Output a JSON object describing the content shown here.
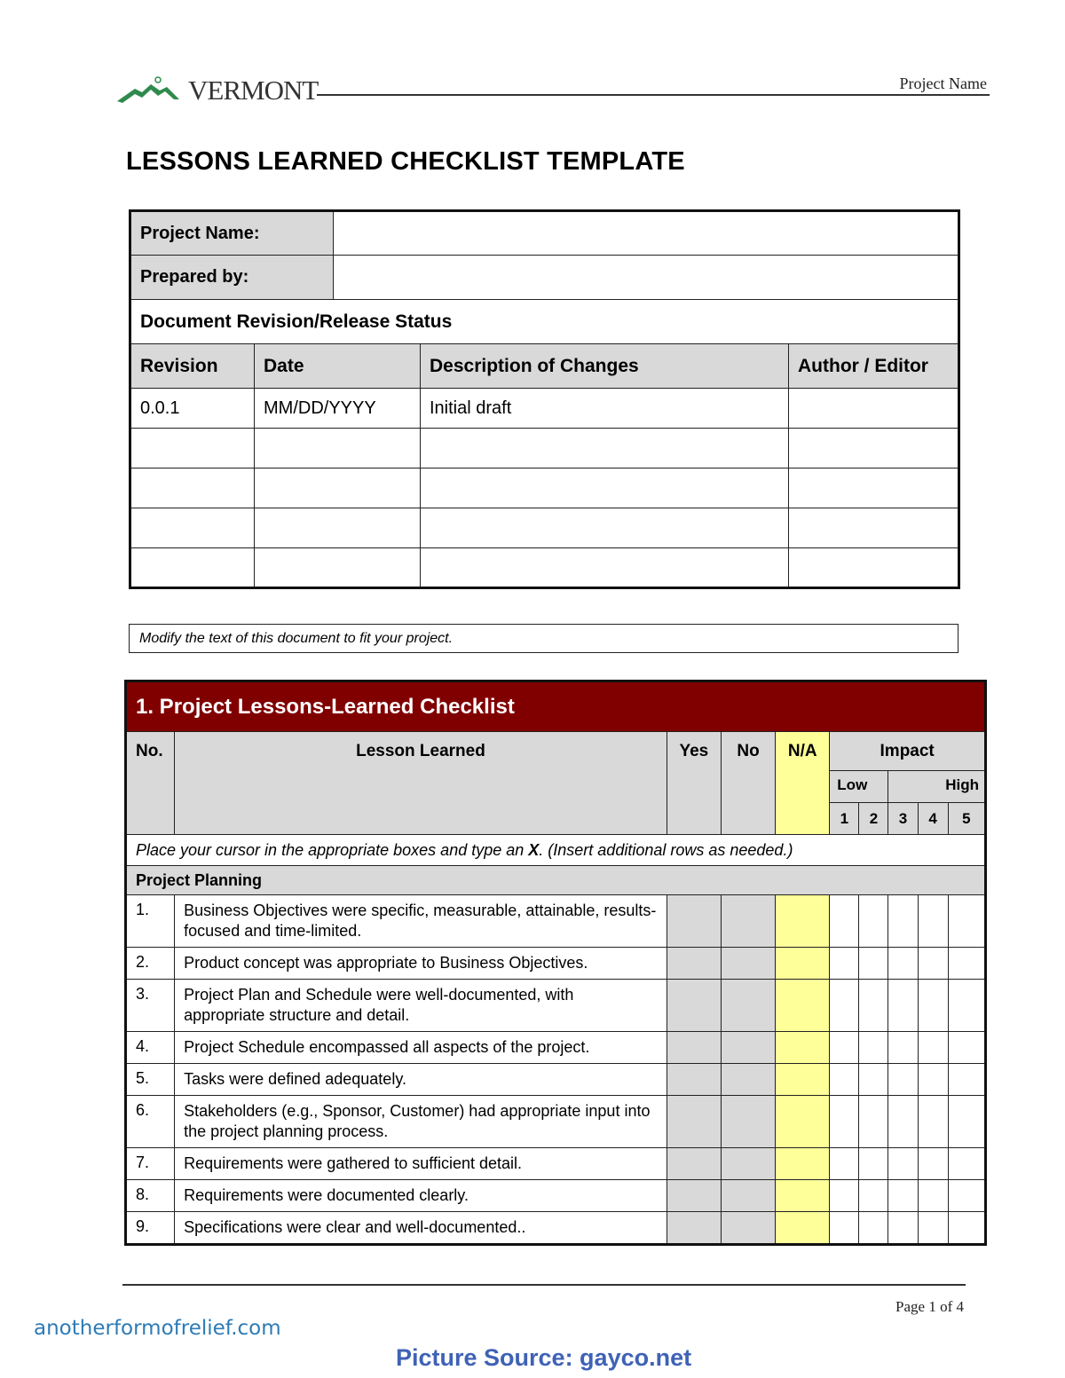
{
  "header": {
    "logo_text": "VERMONT",
    "logo_icon": "green-mountain-logo-icon",
    "project_name_label": "Project Name"
  },
  "document": {
    "title": "LESSONS LEARNED CHECKLIST TEMPLATE"
  },
  "info_table": {
    "project_name_label": "Project Name:",
    "project_name_value": "",
    "prepared_by_label": "Prepared by:",
    "prepared_by_value": "",
    "revision_section_title": "Document Revision/Release Status",
    "columns": [
      "Revision",
      "Date",
      "Description of Changes",
      "Author / Editor"
    ],
    "rows": [
      [
        "0.0.1",
        "MM/DD/YYYY",
        "Initial draft",
        ""
      ],
      [
        "",
        "",
        "",
        ""
      ],
      [
        "",
        "",
        "",
        ""
      ],
      [
        "",
        "",
        "",
        ""
      ],
      [
        "",
        "",
        "",
        ""
      ]
    ]
  },
  "note": "Modify the text of this document to fit your project.",
  "checklist": {
    "section_title": "1.  Project Lessons-Learned Checklist",
    "columns": {
      "no": "No.",
      "lesson": "Lesson Learned",
      "yes": "Yes",
      "no_col": "No",
      "na": "N/A",
      "impact": "Impact",
      "impact_low": "Low",
      "impact_high": "High",
      "impact_scale": [
        "1",
        "2",
        "3",
        "4",
        "5"
      ]
    },
    "instructions_before": "Place your cursor in the appropriate boxes and type an ",
    "instructions_mark": "X",
    "instructions_after": ". (Insert additional rows as needed.)",
    "subsection": "Project Planning",
    "items": [
      {
        "no": "1.",
        "text": "Business Objectives were specific, measurable, attainable, results-focused and time-limited."
      },
      {
        "no": "2.",
        "text": "Product concept was appropriate to Business Objectives."
      },
      {
        "no": "3.",
        "text": "Project Plan and Schedule were well-documented, with appropriate structure and detail."
      },
      {
        "no": "4.",
        "text": "Project Schedule encompassed all aspects of the project."
      },
      {
        "no": "5.",
        "text": "Tasks were defined adequately."
      },
      {
        "no": "6.",
        "text": "Stakeholders (e.g., Sponsor, Customer) had appropriate input into the project planning process."
      },
      {
        "no": "7.",
        "text": "Requirements were gathered to sufficient detail."
      },
      {
        "no": "8.",
        "text": "Requirements were documented clearly."
      },
      {
        "no": "9.",
        "text": "Specifications were clear and well-documented.."
      }
    ]
  },
  "footer": {
    "page_label": "Page 1 of 4"
  },
  "watermarks": {
    "site": "anotherformofrelief.com",
    "source": "Picture Source: gayco.net"
  },
  "colors": {
    "section_header": "#800000",
    "header_gray": "#d9d9d9",
    "na_yellow": "#ffff99",
    "watermark_site": "#2e7bb5",
    "watermark_source": "#3f62b5"
  }
}
